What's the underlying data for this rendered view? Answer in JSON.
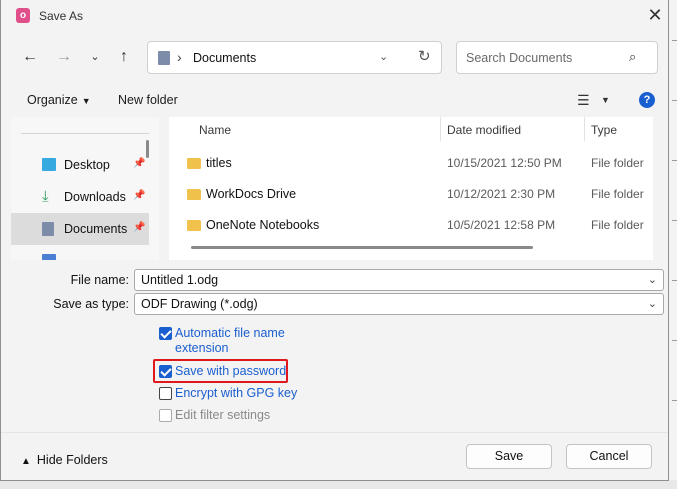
{
  "window": {
    "title": "Save As"
  },
  "nav": {
    "back_icon": "arrow-left-icon",
    "forward_icon": "arrow-right-icon",
    "recent_icon": "chevron-down-icon",
    "up_icon": "arrow-up-icon",
    "path": "Documents",
    "search_placeholder": "Search Documents"
  },
  "toolbar": {
    "organize": "Organize",
    "new_folder": "New folder"
  },
  "sidebar": {
    "items": [
      {
        "label": "Desktop",
        "icon": "desktop-icon",
        "pinned": true
      },
      {
        "label": "Downloads",
        "icon": "download-icon",
        "pinned": true
      },
      {
        "label": "Documents",
        "icon": "document-icon",
        "pinned": true,
        "selected": true
      }
    ]
  },
  "files": {
    "columns": {
      "name": "Name",
      "date": "Date modified",
      "type": "Type"
    },
    "rows": [
      {
        "name": "titles",
        "date": "10/15/2021 12:50 PM",
        "type": "File folder"
      },
      {
        "name": "WorkDocs Drive",
        "date": "10/12/2021 2:30 PM",
        "type": "File folder"
      },
      {
        "name": "OneNote Notebooks",
        "date": "10/5/2021 12:58 PM",
        "type": "File folder"
      }
    ]
  },
  "form": {
    "file_name_label": "File name:",
    "file_name_value": "Untitled 1.odg",
    "save_type_label": "Save as type:",
    "save_type_value": "ODF Drawing (*.odg)"
  },
  "options": {
    "auto_ext_line1": "Automatic file name",
    "auto_ext_line2": "extension",
    "auto_ext_checked": true,
    "password": "Save with password",
    "password_checked": true,
    "gpg": "Encrypt with GPG key",
    "gpg_checked": false,
    "filter": "Edit filter settings",
    "filter_enabled": false
  },
  "footer": {
    "hide_folders": "Hide Folders",
    "save": "Save",
    "cancel": "Cancel"
  },
  "colors": {
    "accent": "#1a5fd0",
    "highlight": "#e0181b",
    "folder": "#f0c14b"
  }
}
